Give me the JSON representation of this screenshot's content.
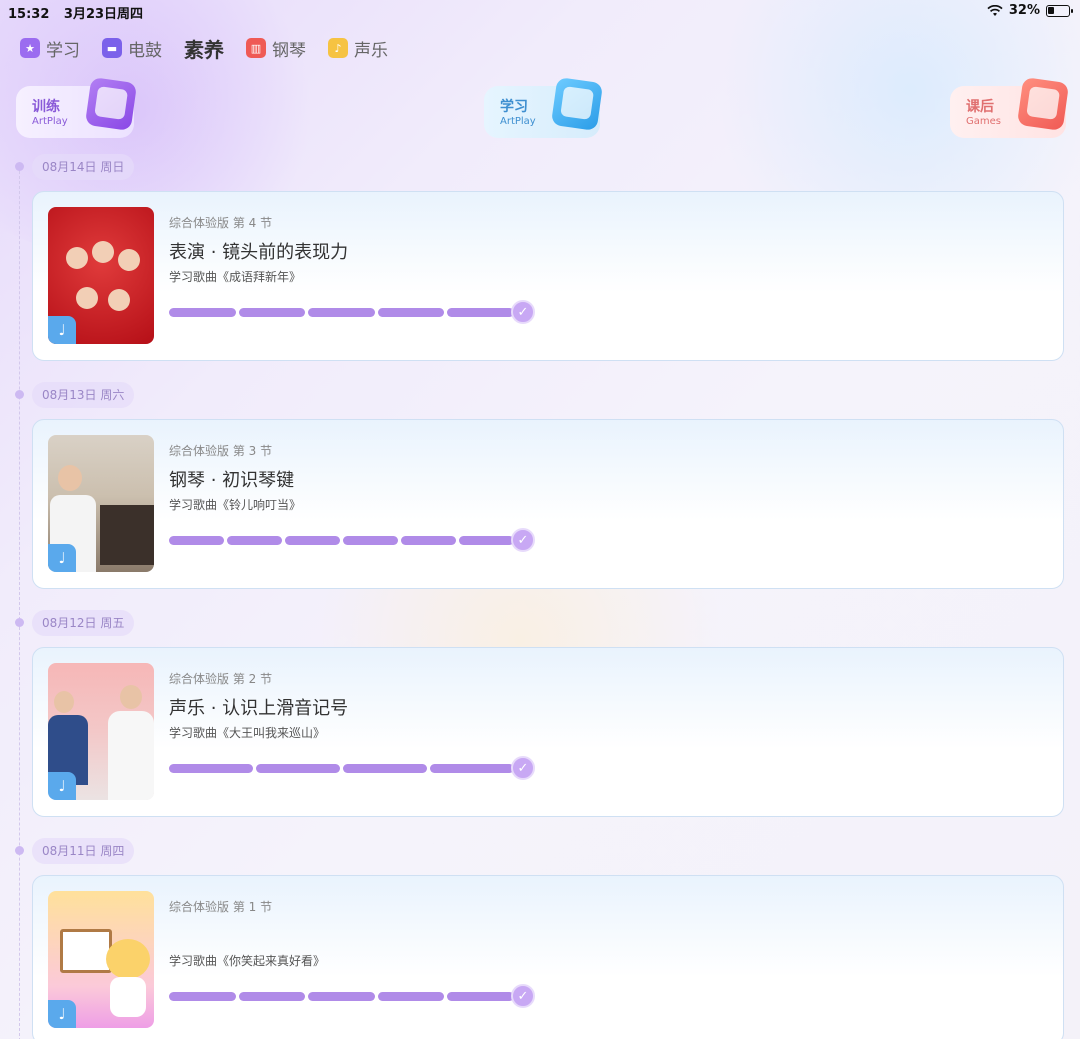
{
  "status": {
    "time": "15:32",
    "date": "3月23日周四",
    "battery": "32%",
    "battery_level": 0.32
  },
  "tabs": [
    {
      "label": "学习",
      "icon": "star-icon",
      "color": "#9b6cf0",
      "active": false
    },
    {
      "label": "电鼓",
      "icon": "drum-icon",
      "color": "#7b61ea",
      "active": false
    },
    {
      "label": "素养",
      "icon": "",
      "color": "",
      "active": true
    },
    {
      "label": "钢琴",
      "icon": "piano-icon",
      "color": "#ef5a55",
      "active": false
    },
    {
      "label": "声乐",
      "icon": "mic-icon",
      "color": "#f6c342",
      "active": false
    }
  ],
  "modes": {
    "train": {
      "label": "训练",
      "sub": "ArtPlay"
    },
    "learn": {
      "label": "学习",
      "sub": "ArtPlay"
    },
    "after": {
      "label": "课后",
      "sub": "Games"
    }
  },
  "lessons": [
    {
      "date": "08月14日 周日",
      "eyebrow": "综合体验版 第 4 节",
      "title": "表演 · 镜头前的表现力",
      "song": "学习歌曲《成语拜新年》",
      "segments": 5
    },
    {
      "date": "08月13日 周六",
      "eyebrow": "综合体验版 第 3 节",
      "title": "钢琴 · 初识琴键",
      "song": "学习歌曲《铃儿响叮当》",
      "segments": 6
    },
    {
      "date": "08月12日 周五",
      "eyebrow": "综合体验版 第 2 节",
      "title": "声乐 · 认识上滑音记号",
      "song": "学习歌曲《大王叫我来巡山》",
      "segments": 4
    },
    {
      "date": "08月11日 周四",
      "eyebrow": "综合体验版 第 1 节",
      "title": "",
      "song": "学习歌曲《你笑起来真好看》",
      "segments": 5
    }
  ]
}
